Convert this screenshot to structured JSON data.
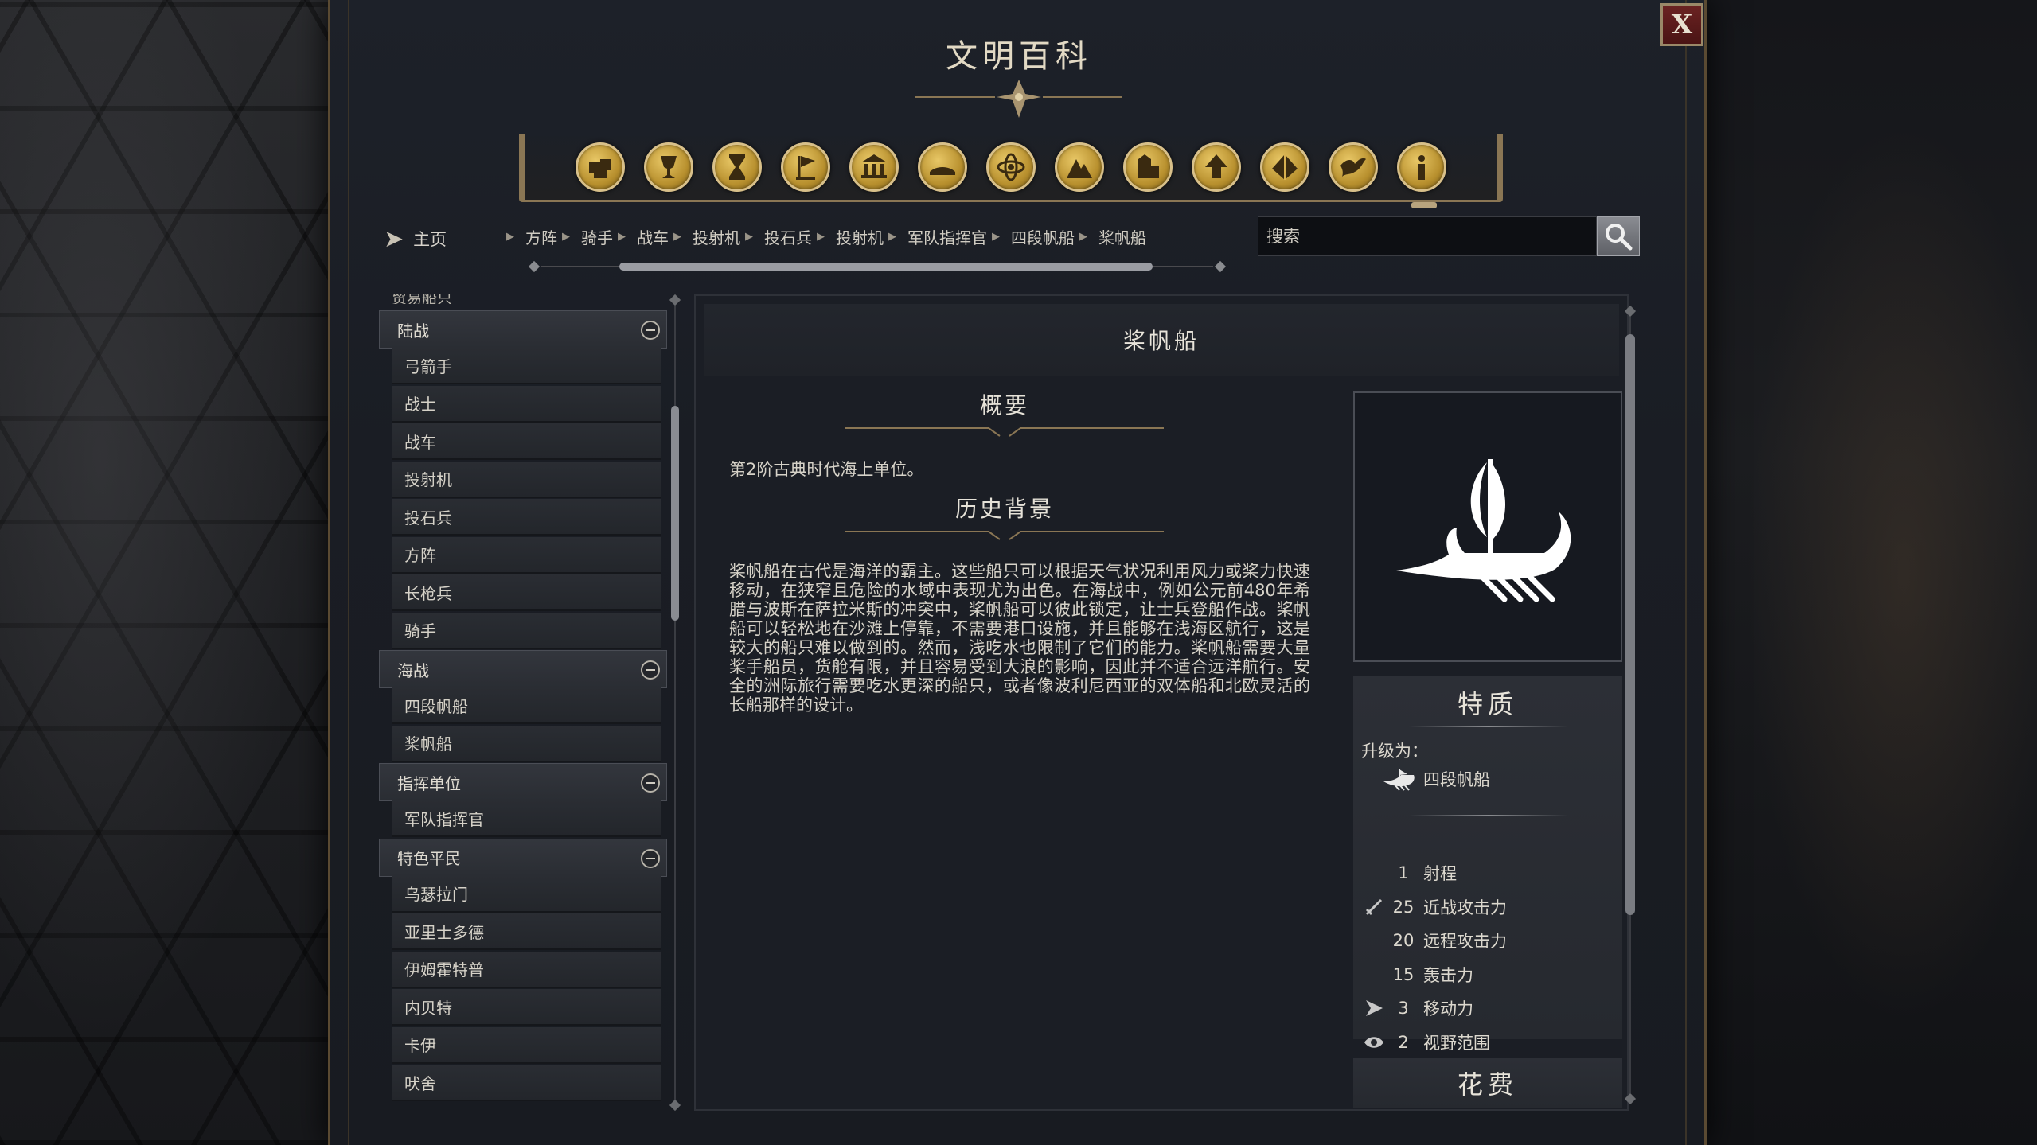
{
  "window": {
    "title": "文明百科",
    "close_label": "X"
  },
  "categories": [
    {
      "name": "concepts-icon"
    },
    {
      "name": "goblet-icon"
    },
    {
      "name": "hourglass-icon"
    },
    {
      "name": "flag-icon"
    },
    {
      "name": "temple-icon"
    },
    {
      "name": "book-icon"
    },
    {
      "name": "atom-icon"
    },
    {
      "name": "mountain-icon"
    },
    {
      "name": "building-icon"
    },
    {
      "name": "upgrade-arrow-icon"
    },
    {
      "name": "wonder-pyramid-icon"
    },
    {
      "name": "dove-icon"
    },
    {
      "name": "info-icon"
    }
  ],
  "home": {
    "label": "主页"
  },
  "breadcrumb": [
    "方阵",
    "骑手",
    "战车",
    "投射机",
    "投石兵",
    "投射机",
    "军队指挥官",
    "四段帆船",
    "桨帆船"
  ],
  "search": {
    "placeholder": "搜索"
  },
  "nav": {
    "partial_item": "贸易船只",
    "groups": [
      {
        "label": "陆战",
        "items": [
          "弓箭手",
          "战士",
          "战车",
          "投射机",
          "投石兵",
          "方阵",
          "长枪兵",
          "骑手"
        ]
      },
      {
        "label": "海战",
        "items": [
          "四段帆船",
          "桨帆船"
        ]
      },
      {
        "label": "指挥单位",
        "items": [
          "军队指挥官"
        ]
      },
      {
        "label": "特色平民",
        "items": [
          "乌瑟拉门",
          "亚里士多德",
          "伊姆霍特普",
          "内贝特",
          "卡伊",
          "吠舍"
        ]
      }
    ]
  },
  "entry": {
    "title": "桨帆船",
    "summary_heading": "概要",
    "summary_text": "第2阶古典时代海上单位。",
    "history_heading": "历史背景",
    "history_text": "桨帆船在古代是海洋的霸主。这些船只可以根据天气状况利用风力或桨力快速移动，在狭窄且危险的水域中表现尤为出色。在海战中，例如公元前480年希腊与波斯在萨拉米斯的冲突中，桨帆船可以彼此锁定，让士兵登船作战。桨帆船可以轻松地在沙滩上停靠，不需要港口设施，并且能够在浅海区航行，这是较大的船只难以做到的。然而，浅吃水也限制了它们的能力。桨帆船需要大量桨手船员，货舱有限，并且容易受到大浪的影响，因此并不适合远洋航行。安全的洲际旅行需要吃水更深的船只，或者像波利尼西亚的双体船和北欧灵活的长船那样的设计。"
  },
  "traits": {
    "title": "特质",
    "upgrade_label": "升级为：",
    "upgrade_target": "四段帆船",
    "stats": [
      {
        "icon": "",
        "value": "1",
        "label": "射程"
      },
      {
        "icon": "sword-icon",
        "value": "25",
        "label": "近战攻击力"
      },
      {
        "icon": "",
        "value": "20",
        "label": "远程攻击力"
      },
      {
        "icon": "",
        "value": "15",
        "label": "轰击力"
      },
      {
        "icon": "movement-arrow-icon",
        "value": "3",
        "label": "移动力"
      },
      {
        "icon": "eye-icon",
        "value": "2",
        "label": "视野范围"
      }
    ]
  },
  "cost": {
    "title": "花费"
  }
}
